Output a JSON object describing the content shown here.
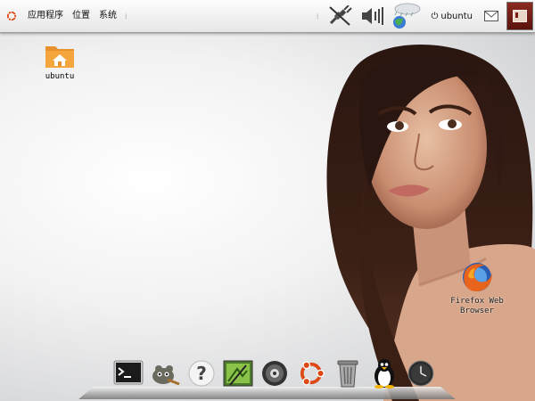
{
  "panel": {
    "menus": [
      {
        "label": "应用程序"
      },
      {
        "label": "位置"
      },
      {
        "label": "系统"
      }
    ],
    "username": "ubuntu",
    "tray_icons": [
      "network-disconnected-icon",
      "volume-icon",
      "weather-icon",
      "power-icon",
      "mail-icon",
      "show-desktop-icon"
    ]
  },
  "desktop": {
    "icons": [
      {
        "label": "ubuntu",
        "icon": "home-folder-icon"
      },
      {
        "label_line1": "Firefox Web",
        "label_line2": "Browser",
        "icon": "firefox-icon"
      }
    ]
  },
  "dock": {
    "items": [
      {
        "icon": "terminal-icon"
      },
      {
        "icon": "gimp-icon"
      },
      {
        "icon": "help-icon"
      },
      {
        "icon": "photo-editor-icon"
      },
      {
        "icon": "media-player-icon"
      },
      {
        "icon": "ubuntu-logo-icon"
      },
      {
        "icon": "trash-icon"
      },
      {
        "icon": "tux-penguin-icon"
      },
      {
        "icon": "clock-icon"
      }
    ]
  },
  "colors": {
    "panel_top": "#fdfdfd",
    "panel_bottom": "#e6e6e6",
    "ubuntu_orange": "#dd4814",
    "folder_orange": "#f0a030"
  }
}
